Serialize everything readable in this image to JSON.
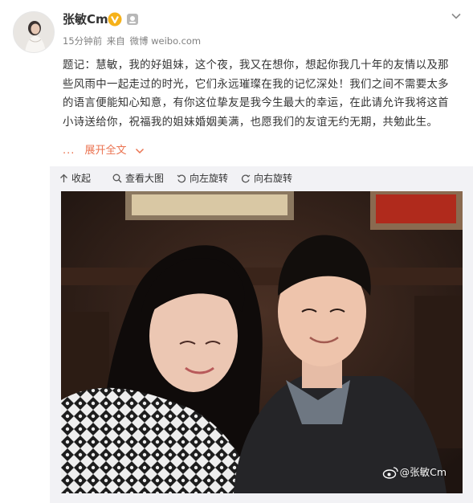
{
  "header": {
    "username": "张敏Cm",
    "time": "15分钟前",
    "from_label": "来自",
    "source": "微博 weibo.com"
  },
  "post": {
    "lines": [
      "题记：慧敏，我的好姐妹，这个夜，我又在想你，想起你我几十年的友情以及那",
      "些风雨中一起走过的时光，它们永远璀璨在我的记忆深处！我们之间不需要太多",
      "的语言便能知心知意，有你这位挚友是我今生最大的幸运，在此请允许我将这首",
      "小诗送给你，祝福我的姐妹婚姻美满，也愿我们的友谊无约无期，共勉此生。"
    ],
    "expand_dots": "...",
    "expand_label": "展开全文"
  },
  "toolbar": {
    "collapse": "收起",
    "view_large": "查看大图",
    "rotate_left": "向左旋转",
    "rotate_right": "向右旋转"
  },
  "photo": {
    "watermark": "@张敏Cm"
  },
  "colors": {
    "link_orange": "#eb7350",
    "meta_gray": "#808080",
    "panel_bg": "#f2f2f5",
    "verified_gold": "#f6b21a"
  },
  "icons": [
    "avatar",
    "verified-v-icon",
    "member-icon",
    "chevron-down-icon",
    "arrow-up-icon",
    "magnifier-icon",
    "rotate-left-icon",
    "rotate-right-icon",
    "weibo-logo-icon"
  ]
}
